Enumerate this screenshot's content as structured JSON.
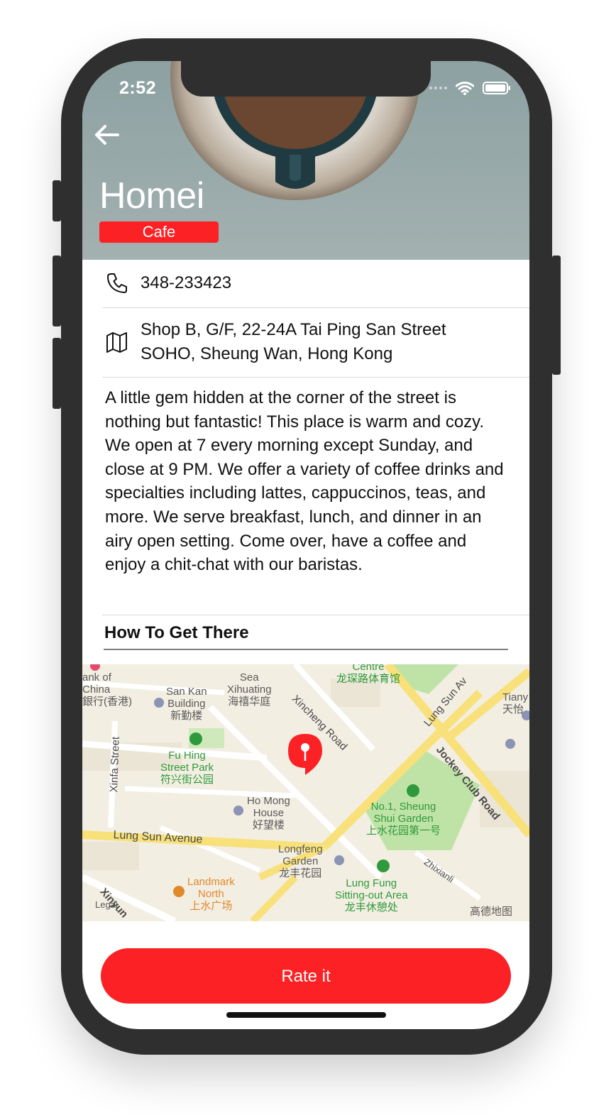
{
  "status_bar": {
    "time": "2:52"
  },
  "restaurant": {
    "name": "Homei",
    "type": "Cafe",
    "phone": "348-233423",
    "address_line1": "Shop B, G/F, 22-24A Tai Ping San Street",
    "address_line2": "SOHO, Sheung Wan, Hong Kong",
    "description": "A little gem hidden at the corner of the street is nothing but fantastic! This place is warm and cozy. We open at 7 every morning except Sunday, and close at 9 PM. We offer a variety of coffee drinks and specialties including lattes, cappuccinos, teas, and more. We serve breakfast, lunch, and dinner in an airy open setting. Come over, have a coffee and enjoy a chit-chat with our baristas."
  },
  "section": {
    "how_to_get_there": "How To Get There"
  },
  "map": {
    "labels": {
      "bank": "ank of\nChina\n銀行(香港)",
      "sea": "Sea\nXihuating\n海禧华庭",
      "centre": "Centre\n龙琛路体育馆",
      "san_kan": "San Kan\nBuilding\n新勤楼",
      "tiany": "Tiany\n天怡",
      "fu_hing": "Fu Hing\nStreet Park\n符兴街公园",
      "ho_mong": "Ho Mong\nHouse\n好望楼",
      "sheung_shui": "No.1, Sheung\nShui Garden\n上水花园第一号",
      "longfeng": "Longfeng\nGarden\n龙丰花园",
      "landmark": "Landmark\nNorth\n上水广场",
      "lung_fung": "Lung Fung\nSitting-out Area\n龙丰休憩处",
      "legal": "Legal",
      "gaode": "高德地图"
    },
    "streets": {
      "xincheng": "Xincheng Road",
      "lung_sun_av": "Lung Sun Av",
      "jockey": "Jockey Club Road",
      "xinfa": "Xinfa Street",
      "lung_sun_avenue": "Lung Sun Avenue",
      "zhixianli": "Zhixianli",
      "xinyun": "Xinyun"
    }
  },
  "actions": {
    "rate": "Rate it"
  },
  "colors": {
    "accent": "#fc2125",
    "map_green": "#2f9a3c"
  }
}
